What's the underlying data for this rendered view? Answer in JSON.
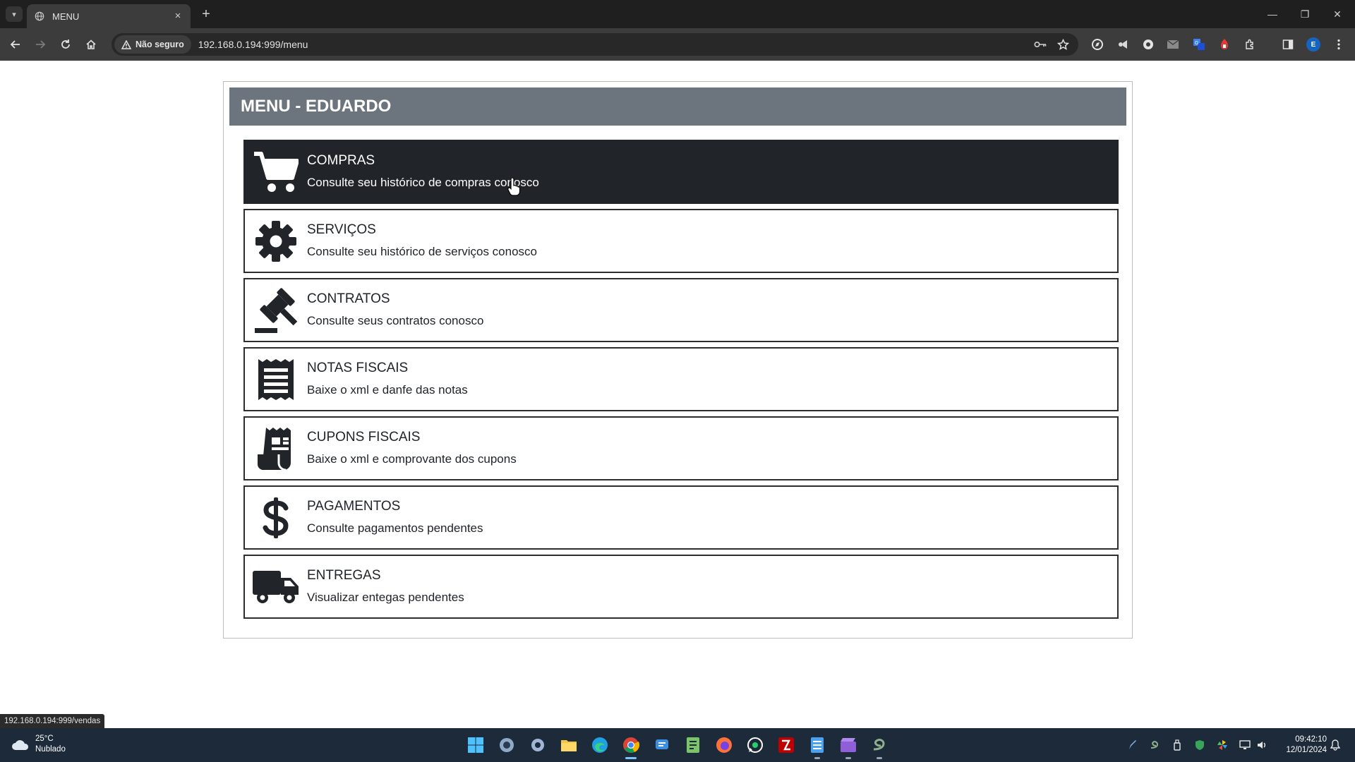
{
  "browser": {
    "tab_title": "MENU",
    "security_label": "Não seguro",
    "url": "192.168.0.194:999/menu",
    "profile_initial": "E",
    "hover_link": "192.168.0.194:999/vendas"
  },
  "page": {
    "header_title": "MENU - EDUARDO",
    "items": [
      {
        "title": "COMPRAS",
        "subtitle": "Consulte seu histórico de compras conosco",
        "icon": "shopping-cart-icon"
      },
      {
        "title": "SERVIÇOS",
        "subtitle": "Consulte seu histórico de serviços conosco",
        "icon": "gear-icon"
      },
      {
        "title": "CONTRATOS",
        "subtitle": "Consulte seus contratos conosco",
        "icon": "gavel-icon"
      },
      {
        "title": "NOTAS FISCAIS",
        "subtitle": "Baixe o xml e danfe das notas",
        "icon": "receipt-icon"
      },
      {
        "title": "CUPONS FISCAIS",
        "subtitle": "Baixe o xml e comprovante dos cupons",
        "icon": "coupon-receipt-icon"
      },
      {
        "title": "PAGAMENTOS",
        "subtitle": "Consulte pagamentos pendentes",
        "icon": "dollar-icon"
      },
      {
        "title": "ENTREGAS",
        "subtitle": "Visualizar entegas pendentes",
        "icon": "truck-icon"
      }
    ],
    "active_item": "COMPRAS"
  },
  "taskbar": {
    "temperature": "25°C",
    "condition": "Nublado",
    "time": "09:42:10",
    "date": "12/01/2024"
  },
  "colors": {
    "header_bg": "#6c757d",
    "active_item_bg": "#212529",
    "chrome_dark": "#1f1f1f",
    "taskbar_bg": "#1c2a3a"
  }
}
